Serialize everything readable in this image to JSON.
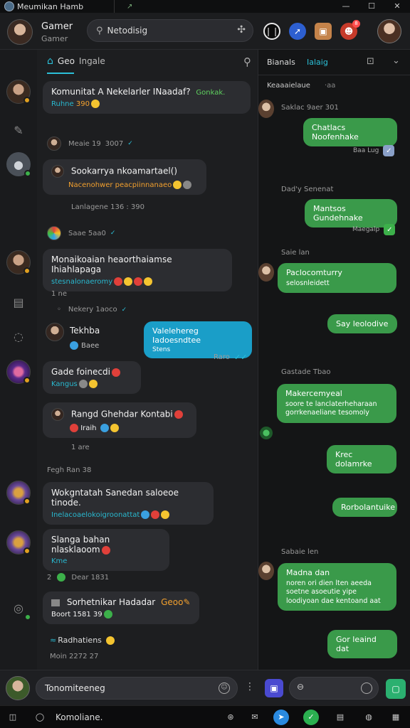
{
  "titlebar": {
    "title": "Meumikan Hamb",
    "mark": "↗",
    "min": "—",
    "max": "☐",
    "close": "✕"
  },
  "header": {
    "name": "Gamer",
    "subtitle": "Gamer",
    "search_value": "Netodisig",
    "search_clear": "✣"
  },
  "header_icons": {
    "notif_count": "8"
  },
  "middle": {
    "tab_label": "Geo",
    "tab_secondary": "Ingale",
    "messages": [
      {
        "text": "Komunitat A Nekelarler INaadaf?",
        "highlight": "Gonkak.",
        "line2": "Ruhne",
        "line2b": "390"
      },
      {
        "author": "Meaie 19",
        "time": "3007"
      },
      {
        "text": "Sookarrya nkoamartael()",
        "line2": "Nacenohwer peacpiinnanaeo"
      },
      {
        "meta": "Lanlagene 136 : 390"
      },
      {
        "author": "Saae 5aa0"
      },
      {
        "text": "Monaikoaian heaorthaiamse Ihiahlapaga",
        "line2": "stesnalonaeromy"
      },
      {
        "meta": "1 ne"
      },
      {
        "meta": "Nekery 1aoco"
      },
      {
        "text": "Tekhba",
        "line2": "Baee"
      },
      {
        "text": "Valelehereg Iadoesndtee",
        "line2": "Stens"
      },
      {
        "meta": "Raro"
      },
      {
        "text": "Gade foinecdi",
        "line2": "Kangus"
      },
      {
        "text": "Rangd Ghehdar Kontabi",
        "line2": "Iraih"
      },
      {
        "meta": "1 are"
      },
      {
        "meta": "Fegh Ran 38"
      },
      {
        "text": "Wokgntatah Sanedan saloeoe tinode.",
        "line2": "Inelacoaelokoigroonattat"
      },
      {
        "text": "Slanga bahan nlasklaoom",
        "line2": "Kme"
      },
      {
        "meta": "Dear 1831"
      },
      {
        "text": "Sorhetnikar Hadadar",
        "highlight": "Geoo",
        "line2": "Boort 1581 39"
      },
      {
        "text": "Radhatiens",
        "meta": "Moin 2272 27"
      }
    ]
  },
  "right": {
    "tab1": "Bianals",
    "tab2": "Ialaig",
    "subheader": "Keaaaielaue",
    "subheader_dot": "·aa",
    "sections": [
      {
        "label": "Saklac 9aer 301"
      },
      {
        "bubble": "Chatlacs Noofenhake",
        "meta": "Baa Lug"
      },
      {
        "label": "Dad'y Senenat"
      },
      {
        "bubble": "Mantsos Gundehnake",
        "meta": "Maegalp"
      },
      {
        "label": "Saie lan"
      },
      {
        "bubble": "Paclocomturry",
        "line2": "selosnleidett"
      },
      {
        "bubble": "Say leolodive"
      },
      {
        "label": "Gastade Tbao"
      },
      {
        "bubble": "Makercemyeal",
        "line2": "soore te lanclaterheharaan gorrkenaeliane tesomoly"
      },
      {
        "bubble": "Krec dolamrke"
      },
      {
        "bubble": "Rorbolantuike"
      },
      {
        "label": "Sabaie len"
      },
      {
        "bubble": "Madna dan",
        "line2": "noren ori dien lten aeeda soetne asoeutie yipe loodiyoan dae kentoand aat"
      },
      {
        "bubble": "Gor leaind dat"
      }
    ]
  },
  "composer": {
    "input_value": "Tonomiteeneg",
    "more": "⋮"
  },
  "taskbar": {
    "label": "Komoliane."
  }
}
